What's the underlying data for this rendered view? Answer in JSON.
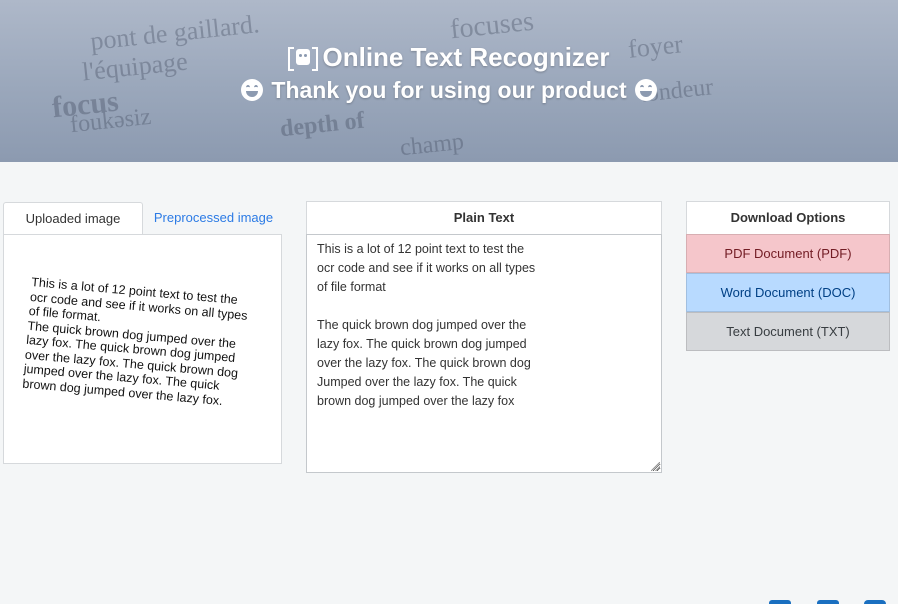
{
  "header": {
    "title": "Online Text Recognizer",
    "subtitle": "Thank you for using our product",
    "background_words": [
      "focuses",
      "pont de gaillard.",
      "l'équipage",
      "focus",
      "foyer",
      "depth of",
      "foukəsiz",
      "champ",
      "tondeur"
    ]
  },
  "tabs": [
    {
      "label": "Uploaded image",
      "active": true
    },
    {
      "label": "Preprocessed image",
      "active": false
    }
  ],
  "uploaded_image": {
    "lines": [
      "This is a lot of 12 point text to test the",
      "ocr code and see if it works on  all types",
      "of file format.",
      "The quick brown dog jumped over the",
      "lazy fox. The quick brown dog jumped",
      "over the lazy fox. The quick brown dog",
      "jumped over the lazy fox. The quick",
      "brown dog jumped over the lazy fox."
    ]
  },
  "plain_text": {
    "heading": "Plain Text",
    "lines": [
      "This is a lot of 12 point text to test the",
      "ocr code and see if it works on all types",
      "of file format",
      "",
      "The quick brown dog jumped over the",
      "lazy fox. The quick brown dog jumped",
      "over the lazy fox. The quick brown dog",
      "Jumped over the lazy fox. The quick",
      "brown dog jumped over the lazy fox"
    ]
  },
  "download": {
    "heading": "Download Options",
    "pdf": "PDF Document (PDF)",
    "doc": "Word Document (DOC)",
    "txt": "Text Document (TXT)"
  },
  "colors": {
    "accent": "#2c7be5",
    "pdf_bg": "#f5c6cb",
    "doc_bg": "#b8daff",
    "txt_bg": "#d6d8db"
  }
}
